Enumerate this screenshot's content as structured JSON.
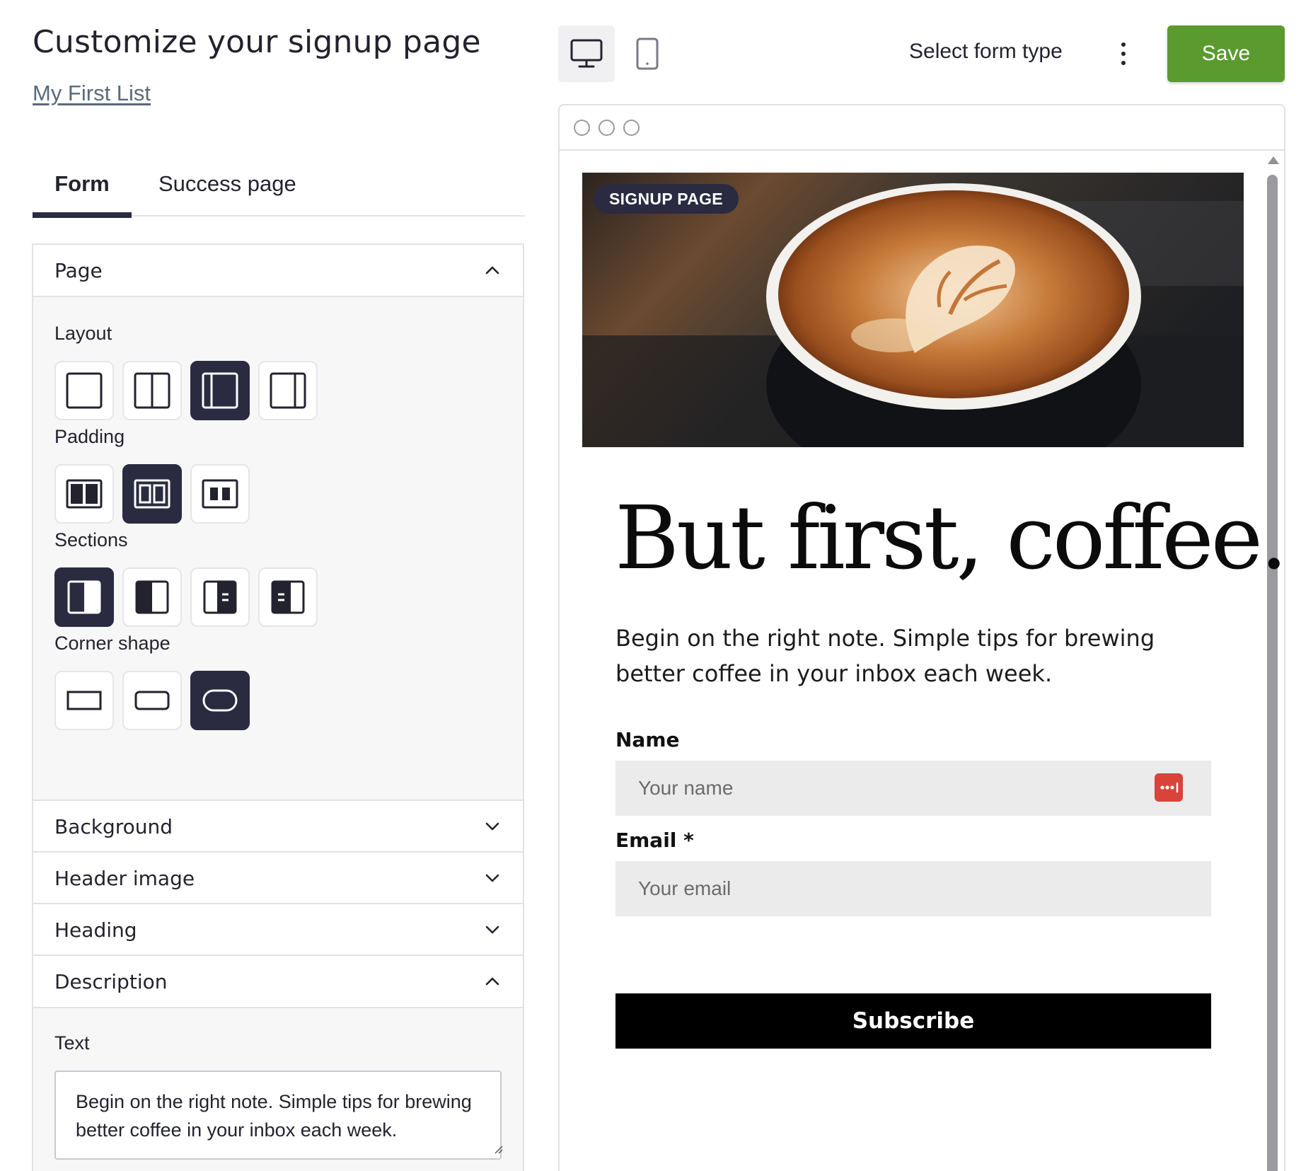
{
  "page": {
    "title": "Customize your signup page",
    "list_link": "My First List"
  },
  "tabs": [
    {
      "label": "Form",
      "active": true
    },
    {
      "label": "Success page",
      "active": false
    }
  ],
  "sections": {
    "page": {
      "label": "Page",
      "expanded": true,
      "layout_label": "Layout",
      "layout_selected_index": 2,
      "padding_label": "Padding",
      "padding_selected_index": 1,
      "sections_label": "Sections",
      "sections_selected_index": 0,
      "corner_label": "Corner shape",
      "corner_selected_index": 2
    },
    "background": {
      "label": "Background",
      "expanded": false
    },
    "header_image": {
      "label": "Header image",
      "expanded": false
    },
    "heading": {
      "label": "Heading",
      "expanded": false
    },
    "description": {
      "label": "Description",
      "expanded": true,
      "text_label": "Text",
      "text_value": "Begin on the right note. Simple tips for brewing better coffee in your inbox each week."
    }
  },
  "toolbar": {
    "desktop_icon": "desktop-icon",
    "mobile_icon": "mobile-icon",
    "form_type_label": "Select form type",
    "more_icon": "more-vertical-icon",
    "save_label": "Save"
  },
  "preview": {
    "badge": "SIGNUP PAGE",
    "heading": "But first, coffee.",
    "description": "Begin on the right note. Simple tips for brewing better coffee in your inbox each week.",
    "name_label": "Name",
    "name_placeholder": "Your name",
    "email_label": "Email *",
    "email_placeholder": "Your email",
    "subscribe_label": "Subscribe"
  },
  "colors": {
    "accent_dark": "#2a2a40",
    "save_green": "#5b9a2f",
    "subscribe_black": "#000000",
    "password_icon_red": "#d8433a"
  }
}
